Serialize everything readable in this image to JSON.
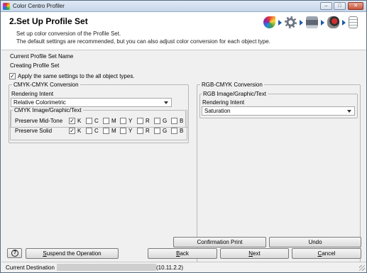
{
  "window": {
    "title": "Color Centro Profiler",
    "minimize": "–",
    "maximize": "□",
    "close": "✕"
  },
  "header": {
    "title": "2.Set Up Profile Set",
    "description_line1": "Set up color conversion of the Profile Set.",
    "description_line2": "The default settings are recommended, but you can also adjust color conversion for each object type.",
    "step_icons": [
      "color-palette-icon",
      "gear-icon",
      "printer-icon",
      "color-measure-icon",
      "document-icon"
    ]
  },
  "profile_set": {
    "name_label": "Current Profile Set Name",
    "name_value": "Creating Profile Set"
  },
  "apply_same": {
    "label": "Apply the same settings to the all object types.",
    "checked": true
  },
  "cmyk": {
    "group_title": "CMYK-CMYK Conversion",
    "rendering_intent_label": "Rendering Intent",
    "rendering_intent_value": "Relative Colorimetric",
    "subgroup_title": "CMYK Image/Graphic/Text",
    "rows": [
      {
        "label": "Preserve Mid-Tone",
        "channels": [
          {
            "name": "K",
            "checked": true
          },
          {
            "name": "C",
            "checked": false
          },
          {
            "name": "M",
            "checked": false
          },
          {
            "name": "Y",
            "checked": false
          },
          {
            "name": "R",
            "checked": false
          },
          {
            "name": "G",
            "checked": false
          },
          {
            "name": "B",
            "checked": false
          }
        ]
      },
      {
        "label": "Preserve Solid",
        "channels": [
          {
            "name": "K",
            "checked": true
          },
          {
            "name": "C",
            "checked": false
          },
          {
            "name": "M",
            "checked": false
          },
          {
            "name": "Y",
            "checked": false
          },
          {
            "name": "R",
            "checked": false
          },
          {
            "name": "G",
            "checked": false
          },
          {
            "name": "B",
            "checked": false
          }
        ]
      }
    ]
  },
  "rgb": {
    "group_title": "RGB-CMYK Conversion",
    "subgroup_title": "RGB Image/Graphic/Text",
    "rendering_intent_label": "Rendering Intent",
    "rendering_intent_value": "Saturation"
  },
  "buttons": {
    "confirmation_print": "Confirmation Print",
    "undo": "Undo",
    "help": "?",
    "suspend_prefix": "S",
    "suspend_rest": "uspend the Operation",
    "back_prefix": "B",
    "back_rest": "ack",
    "next_prefix": "N",
    "next_rest": "ext",
    "cancel_prefix": "C",
    "cancel_rest": "ancel"
  },
  "status": {
    "label": "Current Destination",
    "value": "(10.11.2.2)"
  },
  "colors": {
    "accent": "#1e5aa8",
    "background": "#f0f0f0"
  }
}
